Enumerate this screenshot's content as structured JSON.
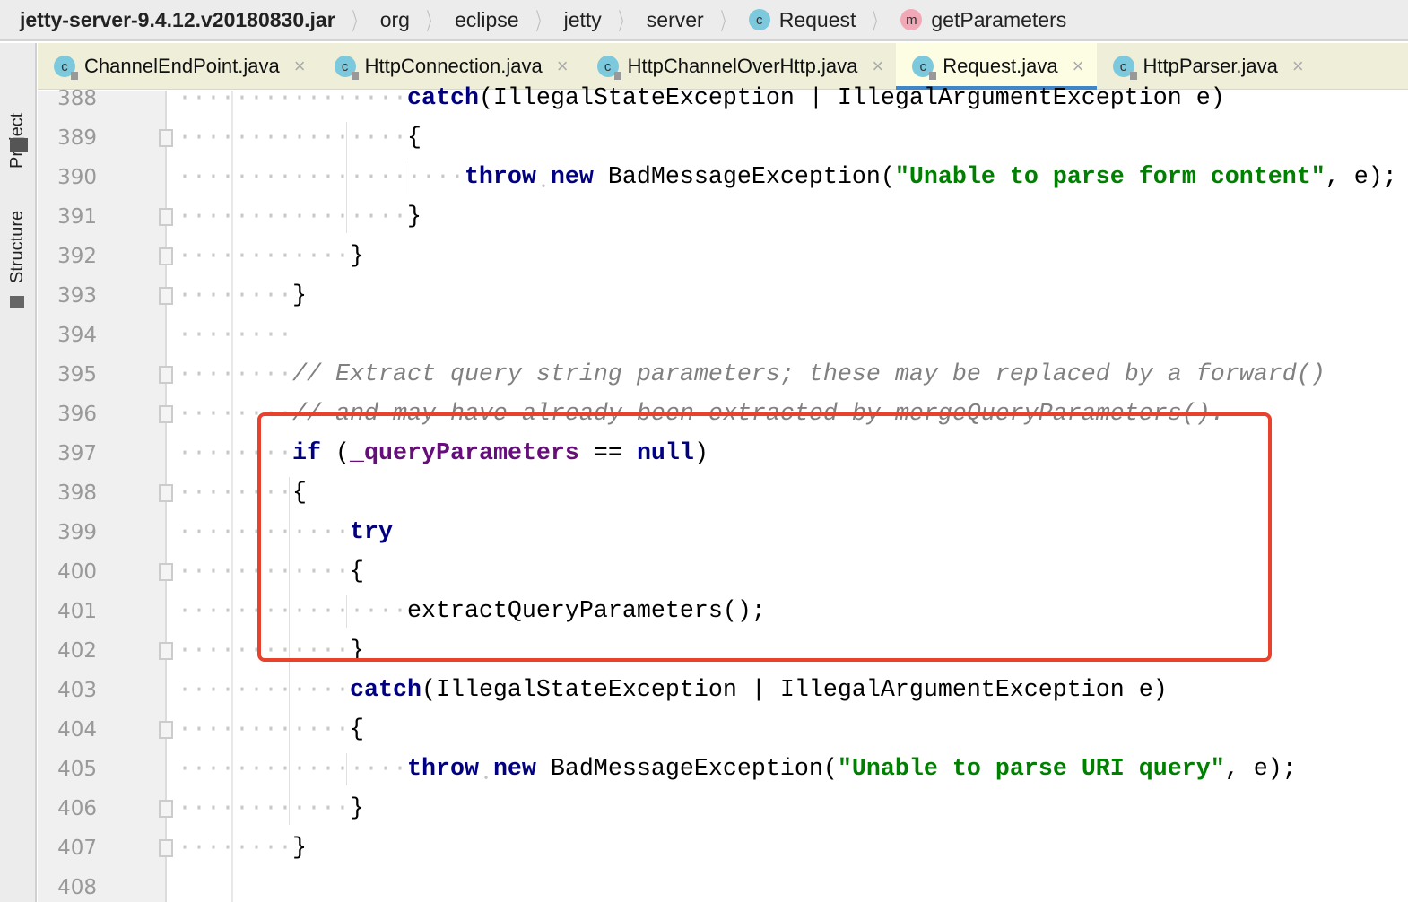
{
  "breadcrumb": [
    {
      "label": "jetty-server-9.4.12.v20180830.jar"
    },
    {
      "label": "org"
    },
    {
      "label": "eclipse"
    },
    {
      "label": "jetty"
    },
    {
      "label": "server"
    },
    {
      "label": "Request",
      "badge": "c"
    },
    {
      "label": "getParameters",
      "badge": "m"
    }
  ],
  "sidebar": {
    "project": "Project",
    "structure": "Structure"
  },
  "tabs": [
    {
      "label": "ChannelEndPoint.java",
      "badge": "c",
      "close": "×"
    },
    {
      "label": "HttpConnection.java",
      "badge": "c",
      "close": "×"
    },
    {
      "label": "HttpChannelOverHttp.java",
      "badge": "c",
      "close": "×"
    },
    {
      "label": "Request.java",
      "badge": "c",
      "close": "×",
      "active": true
    },
    {
      "label": "HttpParser.java",
      "badge": "c",
      "close": "×"
    }
  ],
  "code": [
    {
      "n": "388",
      "i": 4,
      "t": [
        [
          "kw",
          "catch"
        ],
        [
          "",
          "(IllegalStateException | IllegalArgumentException e)"
        ]
      ]
    },
    {
      "n": "389",
      "i": 4,
      "f": "open",
      "t": [
        [
          "",
          "{"
        ]
      ]
    },
    {
      "n": "390",
      "i": 5,
      "t": [
        [
          "kw",
          "throw"
        ],
        [
          "",
          " "
        ],
        [
          "kw",
          "new"
        ],
        [
          "",
          " BadMessageException("
        ],
        [
          "str",
          "\"Unable to parse form content\""
        ],
        [
          "",
          ", e);"
        ]
      ]
    },
    {
      "n": "391",
      "i": 4,
      "f": "close",
      "t": [
        [
          "",
          "}"
        ]
      ]
    },
    {
      "n": "392",
      "i": 3,
      "f": "close",
      "t": [
        [
          "",
          "}"
        ]
      ]
    },
    {
      "n": "393",
      "i": 2,
      "f": "close",
      "t": [
        [
          "",
          "}"
        ]
      ]
    },
    {
      "n": "394",
      "i": 2,
      "t": []
    },
    {
      "n": "395",
      "i": 2,
      "f": "open",
      "t": [
        [
          "cm",
          "// Extract query string parameters; these may be replaced by a forward()"
        ]
      ]
    },
    {
      "n": "396",
      "i": 2,
      "f": "close",
      "t": [
        [
          "cm",
          "// and may have already been extracted by mergeQueryParameters()."
        ]
      ]
    },
    {
      "n": "397",
      "i": 2,
      "t": [
        [
          "kw",
          "if"
        ],
        [
          "",
          " ("
        ],
        [
          "fld",
          "_queryParameters"
        ],
        [
          "",
          " == "
        ],
        [
          "kw",
          "null"
        ],
        [
          "",
          ")"
        ]
      ]
    },
    {
      "n": "398",
      "i": 2,
      "f": "open",
      "t": [
        [
          "",
          "{"
        ]
      ]
    },
    {
      "n": "399",
      "i": 3,
      "t": [
        [
          "kw",
          "try"
        ]
      ]
    },
    {
      "n": "400",
      "i": 3,
      "f": "open",
      "t": [
        [
          "",
          "{"
        ]
      ]
    },
    {
      "n": "401",
      "i": 4,
      "t": [
        [
          "",
          "extractQueryParameters();"
        ]
      ]
    },
    {
      "n": "402",
      "i": 3,
      "f": "close",
      "t": [
        [
          "",
          "}"
        ]
      ]
    },
    {
      "n": "403",
      "i": 3,
      "t": [
        [
          "kw",
          "catch"
        ],
        [
          "",
          "(IllegalStateException | IllegalArgumentException e)"
        ]
      ]
    },
    {
      "n": "404",
      "i": 3,
      "f": "open",
      "t": [
        [
          "",
          "{"
        ]
      ]
    },
    {
      "n": "405",
      "i": 4,
      "t": [
        [
          "kw",
          "throw"
        ],
        [
          "",
          " "
        ],
        [
          "kw",
          "new"
        ],
        [
          "",
          " BadMessageException("
        ],
        [
          "str",
          "\"Unable to parse URI query\""
        ],
        [
          "",
          ", e);"
        ]
      ]
    },
    {
      "n": "406",
      "i": 3,
      "f": "close",
      "t": [
        [
          "",
          "}"
        ]
      ]
    },
    {
      "n": "407",
      "i": 2,
      "f": "close",
      "t": [
        [
          "",
          "}"
        ]
      ]
    },
    {
      "n": "408",
      "i": 0,
      "t": []
    }
  ]
}
